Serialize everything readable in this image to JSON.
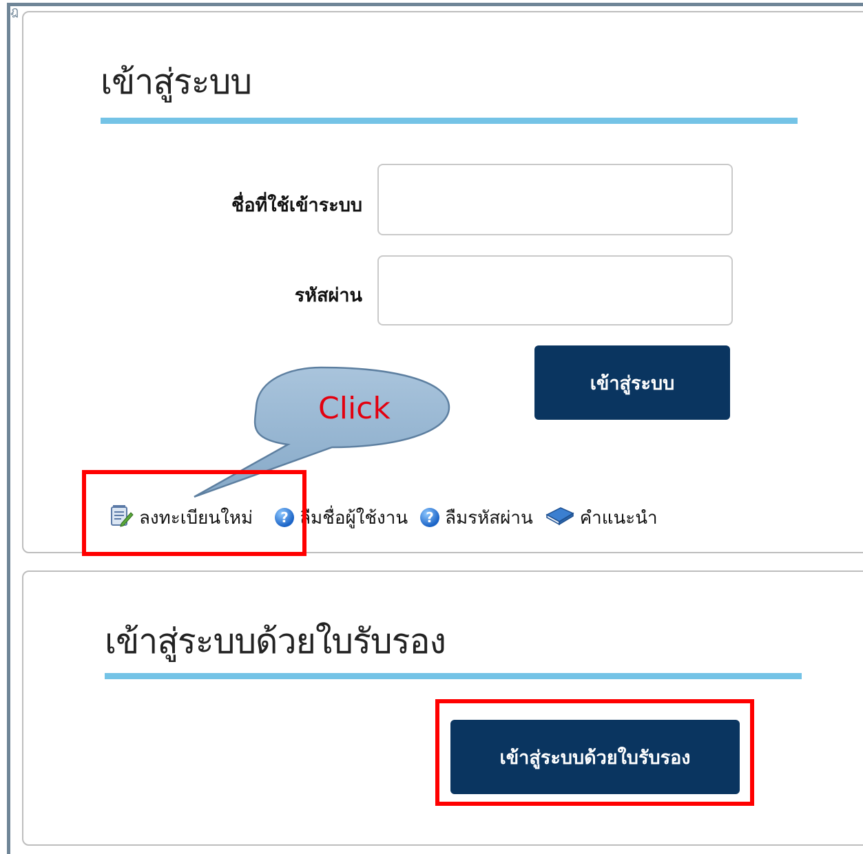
{
  "login": {
    "title": "เข้าสู่ระบบ",
    "username_label": "ชื่อที่ใช้เข้าระบบ",
    "username_value": "",
    "password_label": "รหัสผ่าน",
    "password_value": "",
    "submit_label": "เข้าสู่ระบบ",
    "links": {
      "register": "ลงทะเบียนใหม่",
      "forgot_username": "ลืมชื่อผู้ใช้งาน",
      "forgot_password": "ลืมรหัสผ่าน",
      "guide": "คำแนะนำ"
    }
  },
  "certificate": {
    "title": "เข้าสู่ระบบด้วยใบรับรอง",
    "button_label": "เข้าสู่ระบบด้วยใบรับรอง"
  },
  "annotation": {
    "callout_text": "Click",
    "highlight_color": "#ff0000",
    "callout_fill": "#93b6d3"
  },
  "colors": {
    "button_bg": "#0a3560",
    "rule": "#74c3e6",
    "frame": "#6f8597"
  },
  "icons": {
    "register": "notepad-pencil-icon",
    "forgot_username": "help-icon",
    "forgot_password": "help-icon",
    "guide": "book-icon"
  }
}
